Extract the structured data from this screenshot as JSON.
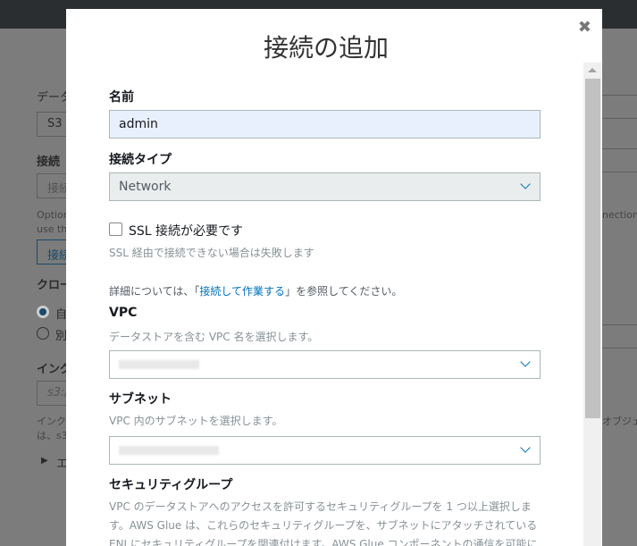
{
  "background": {
    "fragments": [
      "データ",
      "S3",
      "接続",
      "接続",
      "Option",
      "use th",
      "接続",
      "クロー",
      "自",
      "別",
      "イング",
      "s3:/",
      "インク",
      "は、s3",
      "エ",
      "nection",
      "オブジェ"
    ]
  },
  "modal": {
    "title": "接続の追加",
    "close_icon": "close-icon",
    "name_label": "名前",
    "name_value": "admin",
    "type_label": "接続タイプ",
    "type_value": "Network",
    "ssl_label": "SSL 接続が必要です",
    "ssl_checked": false,
    "ssl_hint": "SSL 経由で接続できない場合は失敗します",
    "info_prefix": "詳細については、「",
    "info_link": "接続して作業する",
    "info_suffix": "」を参照してください。",
    "vpc_label": "VPC",
    "vpc_hint": "データストアを含む VPC 名を選択します。",
    "subnet_label": "サブネット",
    "subnet_hint": "VPC 内のサブネットを選択します。",
    "sg_label": "セキュリティグループ",
    "sg_hint_1": "VPC のデータストアへのアクセスを許可するセキュリティグループを 1 つ以上選択しま",
    "sg_hint_2": "す。AWS Glue は、これらのセキュリティグループを、サブネットにアタッチされている",
    "sg_hint_3": "ENI にセキュリティグループを関連付けます。AWS Glue コンポーネントの通信を可能に"
  }
}
